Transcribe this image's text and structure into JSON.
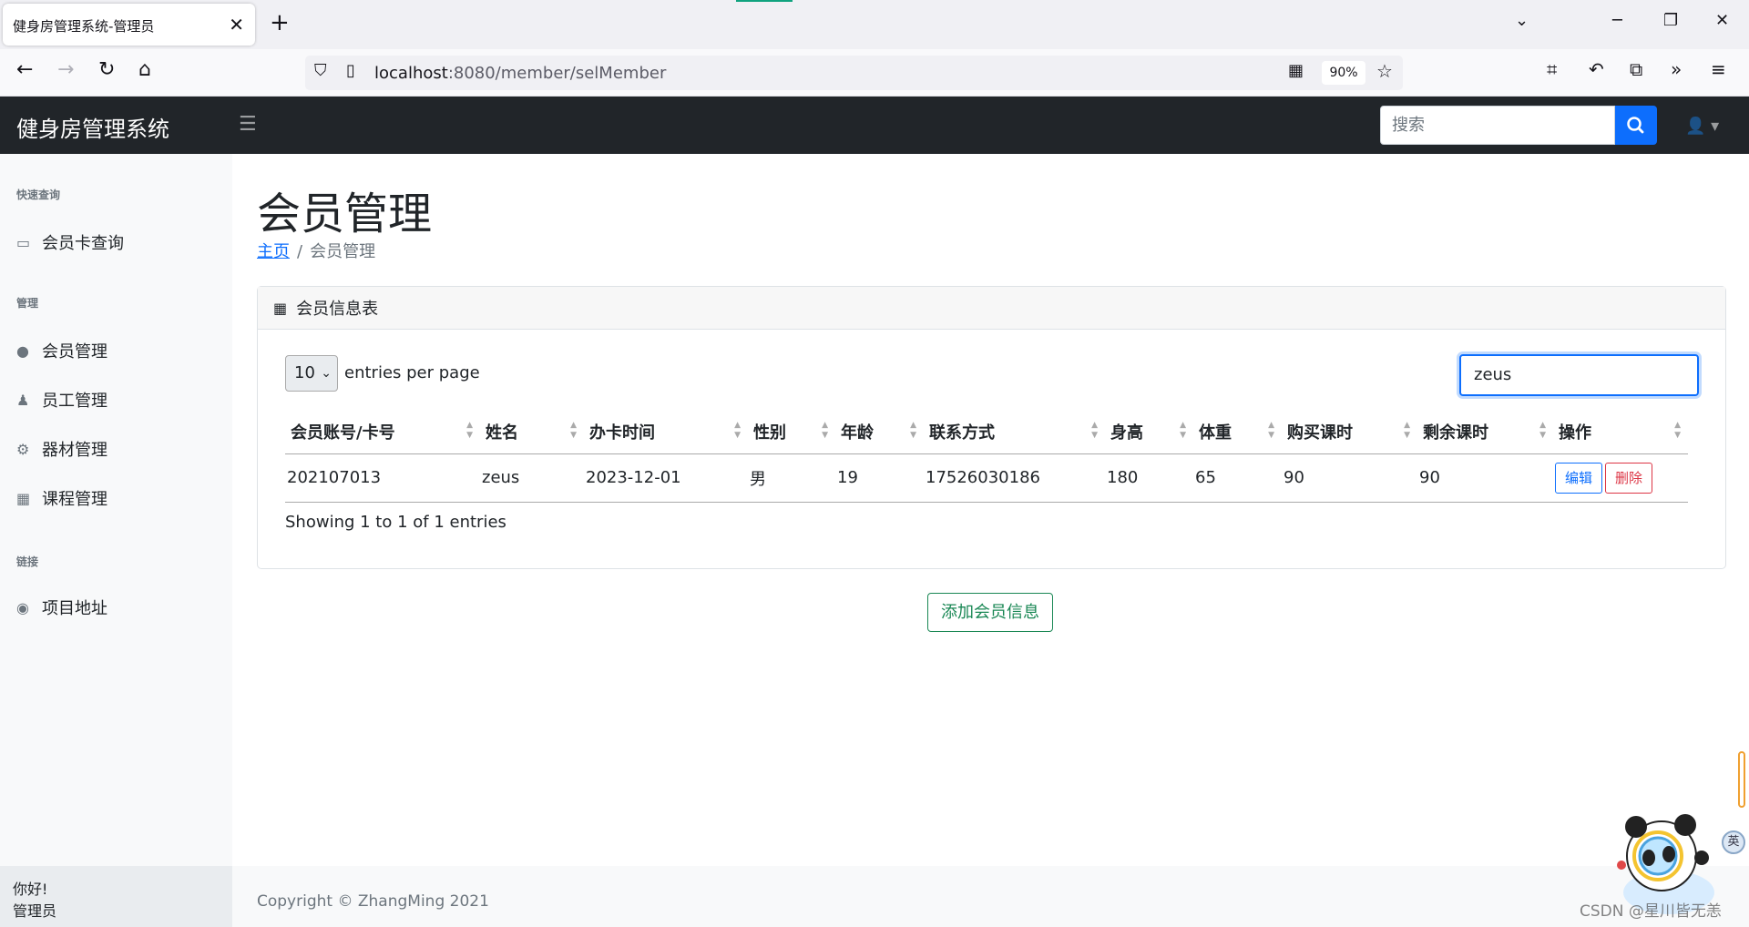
{
  "browser": {
    "tab_title": "健身房管理系统-管理员",
    "url_host": "localhost",
    "url_path": ":8080/member/selMember",
    "zoom": "90%"
  },
  "app": {
    "brand": "健身房管理系统",
    "search_placeholder": "搜索"
  },
  "sidebar": {
    "sections": [
      {
        "heading": "快速查询",
        "items": [
          {
            "label": "会员卡查询",
            "icon": "id-card-icon"
          }
        ]
      },
      {
        "heading": "管理",
        "items": [
          {
            "label": "会员管理",
            "icon": "user-icon"
          },
          {
            "label": "员工管理",
            "icon": "user-tie-icon"
          },
          {
            "label": "器材管理",
            "icon": "equipment-icon"
          },
          {
            "label": "课程管理",
            "icon": "calendar-icon"
          }
        ]
      },
      {
        "heading": "链接",
        "items": [
          {
            "label": "项目地址",
            "icon": "github-icon"
          }
        ]
      }
    ],
    "footer_line1": "你好!",
    "footer_line2": "管理员"
  },
  "main": {
    "title": "会员管理",
    "breadcrumb_home": "主页",
    "breadcrumb_current": "会员管理",
    "card_title": "会员信息表",
    "page_size": "10",
    "entries_label": "entries per page",
    "search_value": "zeus",
    "columns": [
      "会员账号/卡号",
      "姓名",
      "办卡时间",
      "性别",
      "年龄",
      "联系方式",
      "身高",
      "体重",
      "购买课时",
      "剩余课时",
      "操作"
    ],
    "rows": [
      [
        "202107013",
        "zeus",
        "2023-12-01",
        "男",
        "19",
        "17526030186",
        "180",
        "65",
        "90",
        "90"
      ]
    ],
    "edit_label": "编辑",
    "delete_label": "删除",
    "info": "Showing 1 to 1 of 1 entries",
    "add_button": "添加会员信息"
  },
  "footer": {
    "copyright": "Copyright © ZhangMing 2021"
  },
  "overlay": {
    "ime_label": "英",
    "watermark": "CSDN @星川皆无恙"
  },
  "colors": {
    "navbar": "#212529",
    "primary": "#0d6efd",
    "danger": "#dc3545",
    "success": "#198754"
  }
}
